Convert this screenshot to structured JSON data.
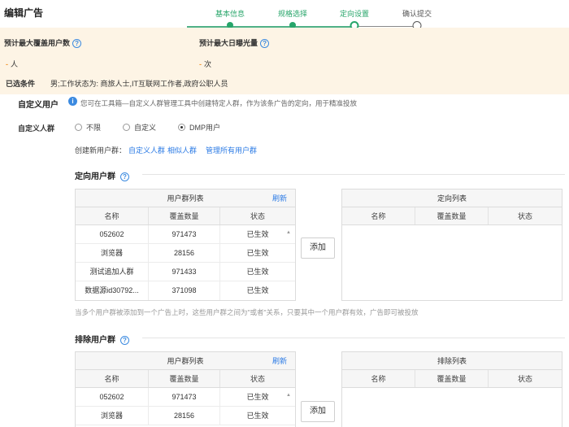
{
  "header": {
    "title": "编辑广告",
    "steps": [
      {
        "label": "基本信息",
        "state": "done"
      },
      {
        "label": "规格选择",
        "state": "done"
      },
      {
        "label": "定向设置",
        "state": "current"
      },
      {
        "label": "确认提交",
        "state": "todo"
      }
    ]
  },
  "summary": {
    "max_users_label": "预计最大覆盖用户数",
    "max_users_value": "人",
    "max_users_dash": "-",
    "max_exposure_label": "预计最大日曝光量",
    "max_exposure_value": "次",
    "max_exposure_dash": "-",
    "conditions_label": "已选条件",
    "conditions_text": "男;工作状态为: 商旅人士,IT互联网工作者,政府公职人员"
  },
  "custom": {
    "title": "自定义用户",
    "info_icon": "i",
    "description": "您可在工具箱—自定义人群管理工具中创建特定人群，作为该条广告的定向，用于精准投放",
    "group_label": "自定义人群",
    "options": [
      {
        "label": "不限",
        "checked": false
      },
      {
        "label": "自定义",
        "checked": false
      },
      {
        "label": "DMP用户",
        "checked": true
      }
    ],
    "create_prefix": "创建新用户群：",
    "create_links": [
      "自定义人群",
      "相似人群",
      "管理所有用户群"
    ]
  },
  "help_icon": "?",
  "targeted": {
    "title": "定向用户群",
    "list_title": "用户群列表",
    "refresh": "刷新",
    "columns": [
      "名称",
      "覆盖数量",
      "状态"
    ],
    "rows": [
      {
        "name": "052602",
        "count": "971473",
        "status": "已生效"
      },
      {
        "name": "浏览器",
        "count": "28156",
        "status": "已生效"
      },
      {
        "name": "测试追加人群",
        "count": "971433",
        "status": "已生效"
      },
      {
        "name": "数据源id30792...",
        "count": "371098",
        "status": "已生效"
      }
    ],
    "add_button": "添加",
    "selected_title": "定向列表",
    "selected_columns": [
      "名称",
      "覆盖数量",
      "状态"
    ]
  },
  "note": "当多个用户群被添加到一个广告上时，这些用户群之间为\"或者\"关系，只要其中一个用户群有效，广告即可被投放",
  "excluded": {
    "title": "排除用户群",
    "list_title": "用户群列表",
    "refresh": "刷新",
    "columns": [
      "名称",
      "覆盖数量",
      "状态"
    ],
    "rows": [
      {
        "name": "052602",
        "count": "971473",
        "status": "已生效"
      },
      {
        "name": "浏览器",
        "count": "28156",
        "status": "已生效"
      }
    ],
    "add_button": "添加",
    "selected_title": "排除列表",
    "selected_columns": [
      "名称",
      "覆盖数量",
      "状态"
    ]
  },
  "colors": {
    "accent_green": "#27a56a",
    "summary_bg": "#fdf4e5",
    "link_blue": "#2c7be5",
    "dash_orange": "#f29c38"
  }
}
